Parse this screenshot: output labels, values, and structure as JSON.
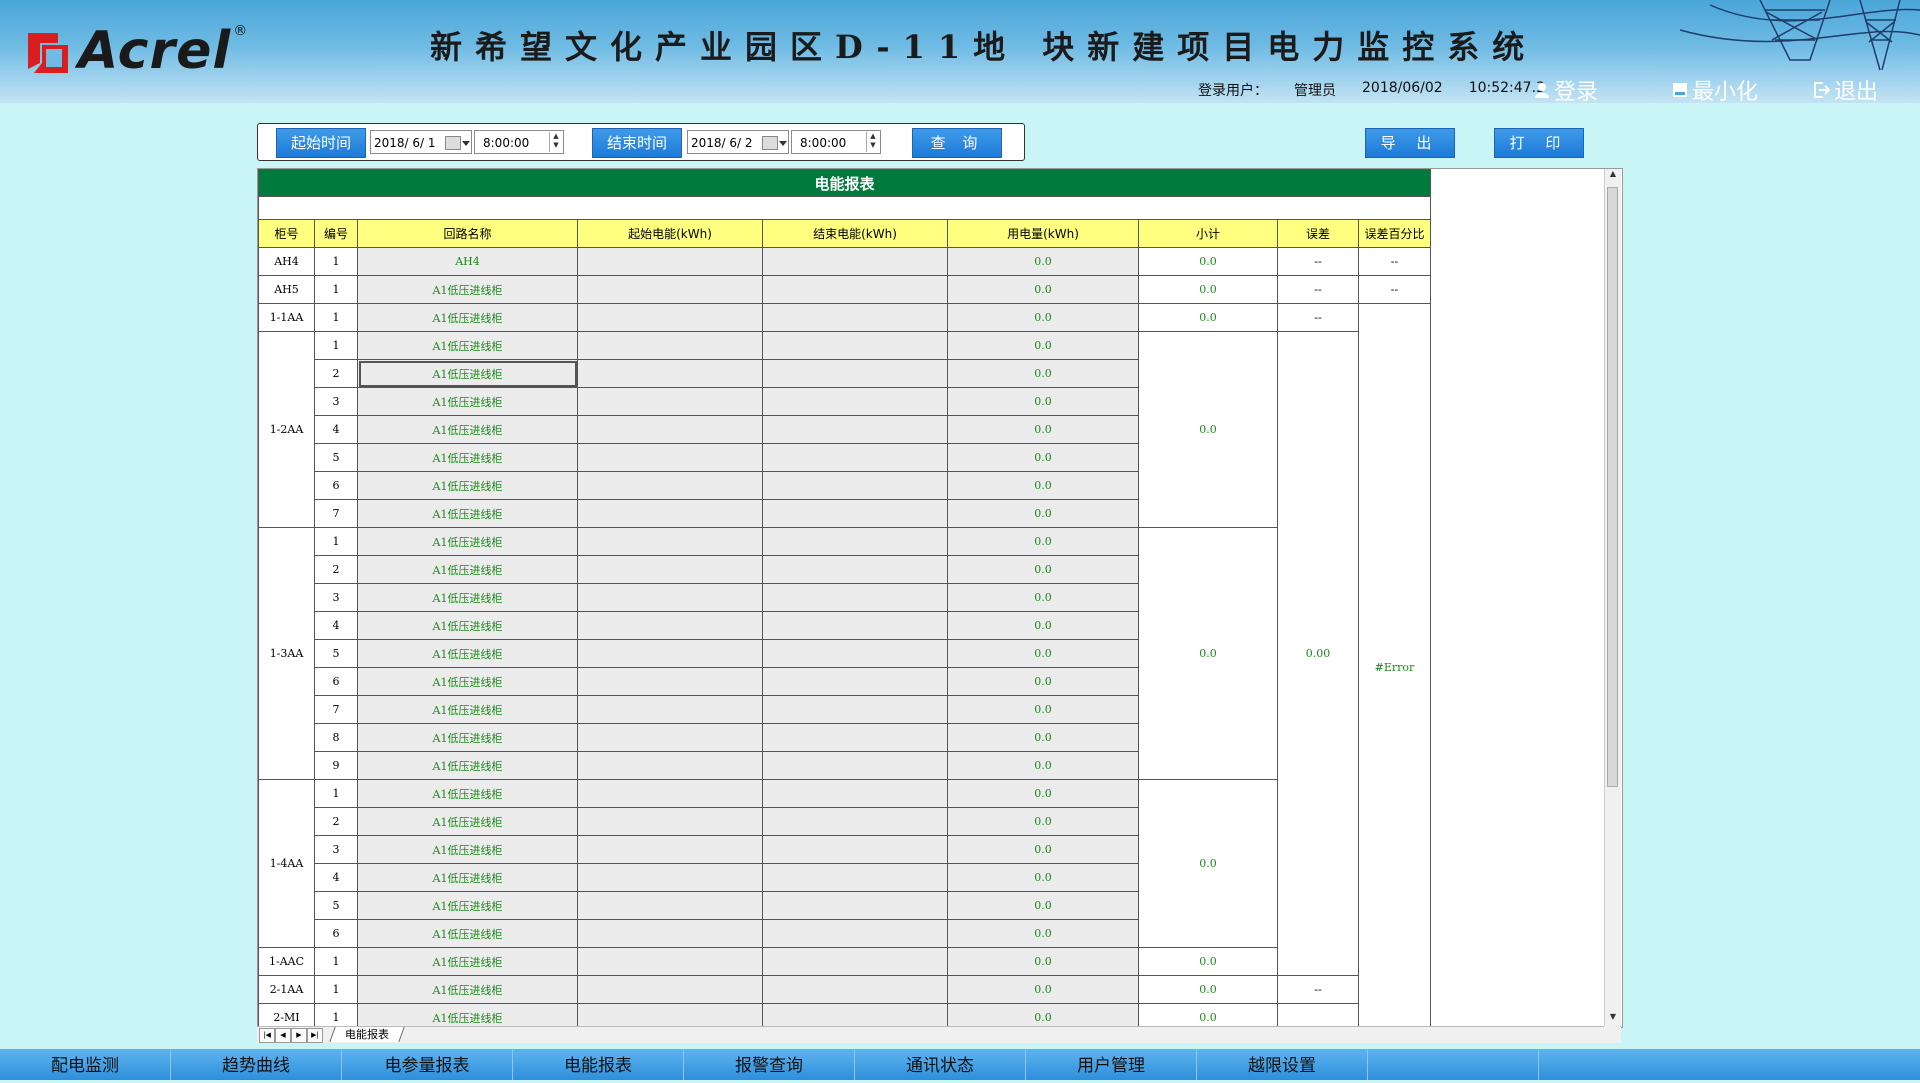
{
  "header": {
    "logo_text": "Acrel",
    "logo_reg": "®",
    "title": "新希望文化产业园区D-11地 块新建项目电力监控系统",
    "login_user_label": "登录用户：",
    "user_name": "管理员",
    "date": "2018/06/02",
    "time": "10:52:47.3",
    "login_label": "登录",
    "minimize_label": "最小化",
    "exit_label": "退出"
  },
  "toolbar": {
    "start_label": "起始时间",
    "start_date": "2018/ 6/ 1",
    "start_time": "8:00:00",
    "end_label": "结束时间",
    "end_date": "2018/ 6/ 2",
    "end_time": "8:00:00",
    "query_label": "查 询",
    "export_label": "导 出",
    "print_label": "打 印"
  },
  "report": {
    "title": "电能报表",
    "columns": [
      "柜号",
      "编号",
      "回路名称",
      "起始电能(kWh)",
      "结束电能(kWh)",
      "用电量(kWh)",
      "小计",
      "误差",
      "误差百分比"
    ],
    "groups": [
      {
        "cabinet": "AH4",
        "subtotal": "0.0",
        "error": "--",
        "error_pct": "--",
        "rows": [
          {
            "no": "1",
            "name": "AH4",
            "usage": "0.0"
          }
        ]
      },
      {
        "cabinet": "AH5",
        "subtotal": "0.0",
        "error": "--",
        "error_pct": "--",
        "rows": [
          {
            "no": "1",
            "name": "A1低压进线柜",
            "usage": "0.0"
          }
        ]
      },
      {
        "cabinet": "1-1AA",
        "subtotal": "0.0",
        "error": "--",
        "rows": [
          {
            "no": "1",
            "name": "A1低压进线柜",
            "usage": "0.0"
          }
        ]
      },
      {
        "cabinet": "1-2AA",
        "subtotal": "0.0",
        "rows": [
          {
            "no": "1",
            "name": "A1低压进线柜",
            "usage": "0.0"
          },
          {
            "no": "2",
            "name": "A1低压进线柜",
            "usage": "0.0"
          },
          {
            "no": "3",
            "name": "A1低压进线柜",
            "usage": "0.0"
          },
          {
            "no": "4",
            "name": "A1低压进线柜",
            "usage": "0.0"
          },
          {
            "no": "5",
            "name": "A1低压进线柜",
            "usage": "0.0"
          },
          {
            "no": "6",
            "name": "A1低压进线柜",
            "usage": "0.0"
          },
          {
            "no": "7",
            "name": "A1低压进线柜",
            "usage": "0.0"
          }
        ]
      },
      {
        "cabinet": "1-3AA",
        "subtotal": "0.0",
        "rows": [
          {
            "no": "1",
            "name": "A1低压进线柜",
            "usage": "0.0"
          },
          {
            "no": "2",
            "name": "A1低压进线柜",
            "usage": "0.0"
          },
          {
            "no": "3",
            "name": "A1低压进线柜",
            "usage": "0.0"
          },
          {
            "no": "4",
            "name": "A1低压进线柜",
            "usage": "0.0"
          },
          {
            "no": "5",
            "name": "A1低压进线柜",
            "usage": "0.0"
          },
          {
            "no": "6",
            "name": "A1低压进线柜",
            "usage": "0.0"
          },
          {
            "no": "7",
            "name": "A1低压进线柜",
            "usage": "0.0"
          },
          {
            "no": "8",
            "name": "A1低压进线柜",
            "usage": "0.0"
          },
          {
            "no": "9",
            "name": "A1低压进线柜",
            "usage": "0.0"
          }
        ]
      },
      {
        "cabinet": "1-4AA",
        "subtotal": "0.0",
        "rows": [
          {
            "no": "1",
            "name": "A1低压进线柜",
            "usage": "0.0"
          },
          {
            "no": "2",
            "name": "A1低压进线柜",
            "usage": "0.0"
          },
          {
            "no": "3",
            "name": "A1低压进线柜",
            "usage": "0.0"
          },
          {
            "no": "4",
            "name": "A1低压进线柜",
            "usage": "0.0"
          },
          {
            "no": "5",
            "name": "A1低压进线柜",
            "usage": "0.0"
          },
          {
            "no": "6",
            "name": "A1低压进线柜",
            "usage": "0.0"
          }
        ]
      },
      {
        "cabinet": "1-AAC",
        "subtotal": "0.0",
        "rows": [
          {
            "no": "1",
            "name": "A1低压进线柜",
            "usage": "0.0"
          }
        ]
      },
      {
        "cabinet": "2-1AA",
        "subtotal": "0.0",
        "error": "--",
        "rows": [
          {
            "no": "1",
            "name": "A1低压进线柜",
            "usage": "0.0"
          }
        ]
      },
      {
        "cabinet": "2-MI",
        "subtotal": "0.0",
        "rows": [
          {
            "no": "1",
            "name": "A1低压进线柜",
            "usage": "0.0"
          }
        ]
      }
    ],
    "merged_error": "0.00",
    "merged_error_pct": "#Error",
    "sheet_tab": "电能报表"
  },
  "bottom_nav": [
    "配电监测",
    "趋势曲线",
    "电参量报表",
    "电能报表",
    "报警查询",
    "通讯状态",
    "用户管理",
    "越限设置",
    "",
    ""
  ],
  "colors": {
    "banner": "#007a3d",
    "header_row": "#ffff80",
    "value_green": "#1a8a1a",
    "button": "#1d7ad8"
  },
  "icons": [
    "user-icon",
    "minimize-icon",
    "exit-icon",
    "calendar-icon",
    "spin-up-icon",
    "spin-down-icon"
  ]
}
